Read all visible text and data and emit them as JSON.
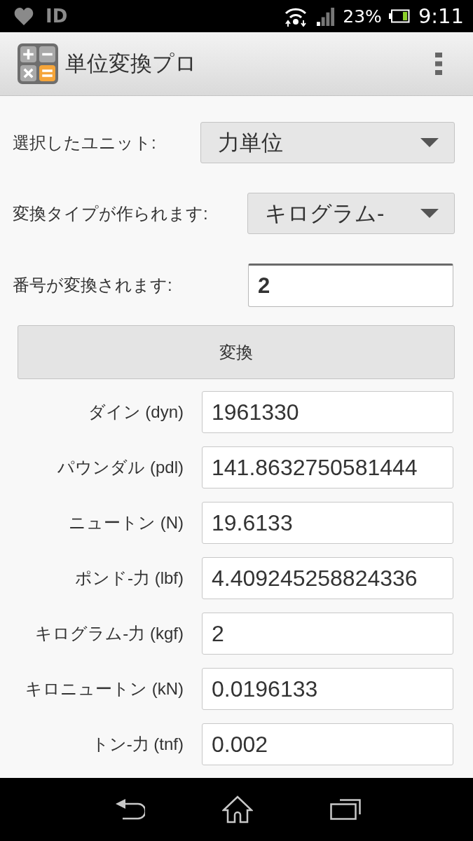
{
  "status_bar": {
    "left_text": "ID",
    "battery_percent": "23%",
    "time": "9:11"
  },
  "app_bar": {
    "title": "単位変換プロ"
  },
  "form": [
    {
      "kind": "dropdown",
      "label": "選択したユニット:",
      "value": "力単位"
    },
    {
      "kind": "dropdown",
      "label": "変換タイプが作られます:",
      "value": "キログラム-"
    },
    {
      "kind": "input",
      "label": "番号が変換されます:",
      "value": "2"
    }
  ],
  "convert_button": {
    "label": "変換"
  },
  "results": [
    {
      "label": "ダイン (dyn)",
      "value": "1961330"
    },
    {
      "label": "パウンダル (pdl)",
      "value": "141.8632750581444"
    },
    {
      "label": "ニュートン (N)",
      "value": "19.6133"
    },
    {
      "label": "ポンド-力 (lbf)",
      "value": "4.409245258824336"
    },
    {
      "label": "キログラム-力 (kgf)",
      "value": "2"
    },
    {
      "label": "キロニュートン (kN)",
      "value": "0.0196133"
    },
    {
      "label": "トン-力 (tnf)",
      "value": "0.002"
    }
  ]
}
